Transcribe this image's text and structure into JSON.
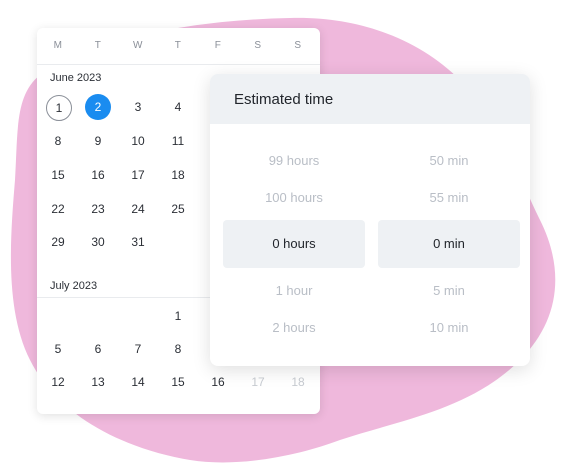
{
  "calendar": {
    "weekdays": [
      "M",
      "T",
      "W",
      "T",
      "F",
      "S",
      "S"
    ],
    "june": {
      "label": "June 2023",
      "days": [
        "1",
        "2",
        "3",
        "4",
        "8",
        "9",
        "10",
        "11",
        "15",
        "16",
        "17",
        "18",
        "22",
        "23",
        "24",
        "25",
        "29",
        "30",
        "31"
      ]
    },
    "july": {
      "label": "July 2023",
      "days": [
        "1",
        "5",
        "6",
        "7",
        "8",
        "12",
        "13",
        "14",
        "15",
        "16",
        "17",
        "18"
      ]
    }
  },
  "estimated_time": {
    "title": "Estimated time",
    "hours": [
      "99 hours",
      "100 hours",
      "0 hours",
      "1 hour",
      "2 hours"
    ],
    "minutes": [
      "50 min",
      "55 min",
      "0 min",
      "5 min",
      "10 min"
    ],
    "selected_hours": "0 hours",
    "selected_minutes": "0 min"
  },
  "colors": {
    "accent": "#1a8cf0",
    "blob": "#efb8dc"
  }
}
